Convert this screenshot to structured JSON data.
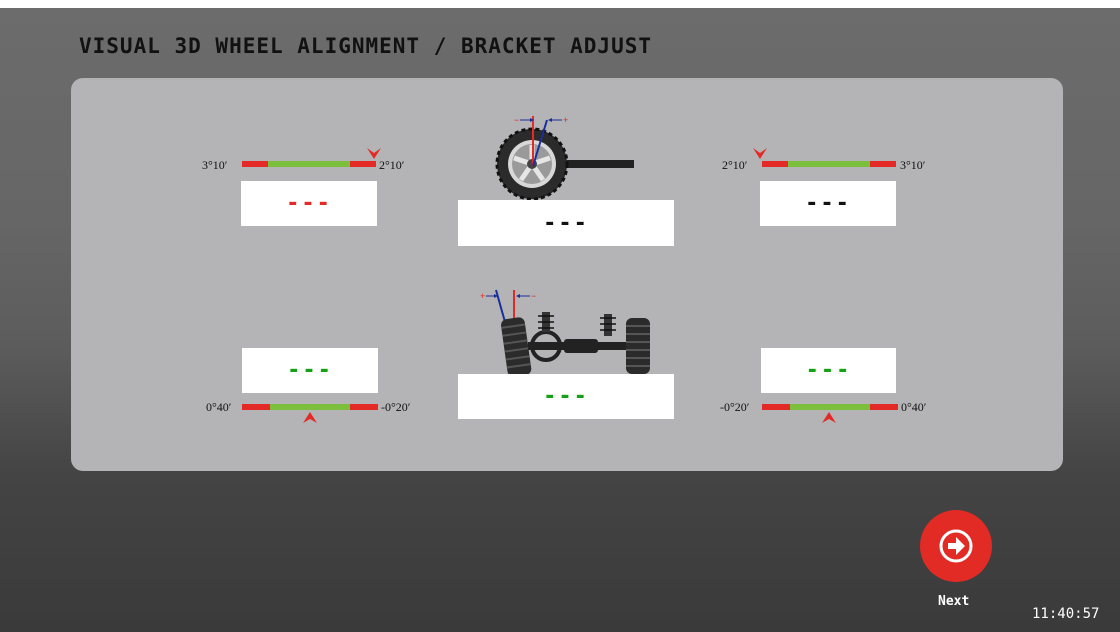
{
  "header": {
    "title": "VISUAL 3D WHEEL ALIGNMENT / BRACKET ADJUST"
  },
  "caster": {
    "left": {
      "min_label": "3°10′",
      "max_label": "2°10′",
      "readout": "---"
    },
    "center": {
      "readout": "---"
    },
    "right": {
      "min_label": "2°10′",
      "max_label": "3°10′",
      "readout": "---"
    }
  },
  "camber": {
    "left": {
      "min_label": "0°40′",
      "max_label": "-0°20′",
      "readout": "---"
    },
    "center": {
      "readout": "---"
    },
    "right": {
      "min_label": "-0°20′",
      "max_label": "0°40′",
      "readout": "---"
    }
  },
  "illustrations": {
    "caster_icons": [
      "wheel-icon",
      "caster-indicator-icon"
    ],
    "camber_icons": [
      "axle-icon",
      "camber-indicator-icon"
    ],
    "caster_minus": "−",
    "caster_plus": "+",
    "camber_plus": "+",
    "camber_minus": "−"
  },
  "footer": {
    "next_label": "Next",
    "clock": "11:40:57",
    "next_icon": "arrow-right-circle-icon"
  },
  "colors": {
    "accent_red": "#e32a26",
    "ok_green": "#7cbf3c",
    "panel": "#b4b4b6"
  }
}
